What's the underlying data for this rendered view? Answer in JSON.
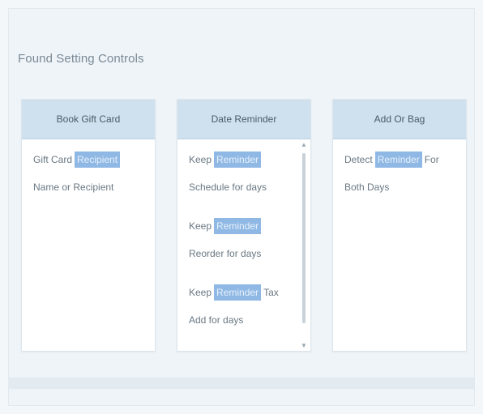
{
  "page": {
    "title": "Found Setting Controls"
  },
  "cards": [
    {
      "header": "Book Gift Card",
      "lines": [
        {
          "before": "Gift Card",
          "highlight": "Recipient",
          "after": ""
        },
        {
          "before": "Name or Recipient",
          "highlight": "",
          "after": ""
        }
      ]
    },
    {
      "header": "Date Reminder",
      "groups": [
        {
          "line1": {
            "before": "Keep",
            "highlight": "Reminder",
            "after": ""
          },
          "line2": "Schedule for days"
        },
        {
          "line1": {
            "before": "Keep",
            "highlight": "Reminder",
            "after": ""
          },
          "line2": "Reorder for days"
        },
        {
          "line1": {
            "before": "Keep",
            "highlight": "Reminder",
            "after": "Tax"
          },
          "line2": "Add for days"
        }
      ]
    },
    {
      "header": "Add Or Bag",
      "lines": [
        {
          "before": "Detect",
          "highlight": "Reminder",
          "after": "For"
        },
        {
          "before": "Both Days",
          "highlight": "",
          "after": ""
        }
      ]
    }
  ],
  "icons": {
    "scroll_up": "triangle-up-icon",
    "scroll_down": "triangle-down-icon"
  },
  "colors": {
    "card_header_bg": "#cfe1ee",
    "highlight_bg": "#8fb8e4",
    "page_bg": "#eef4f8"
  }
}
